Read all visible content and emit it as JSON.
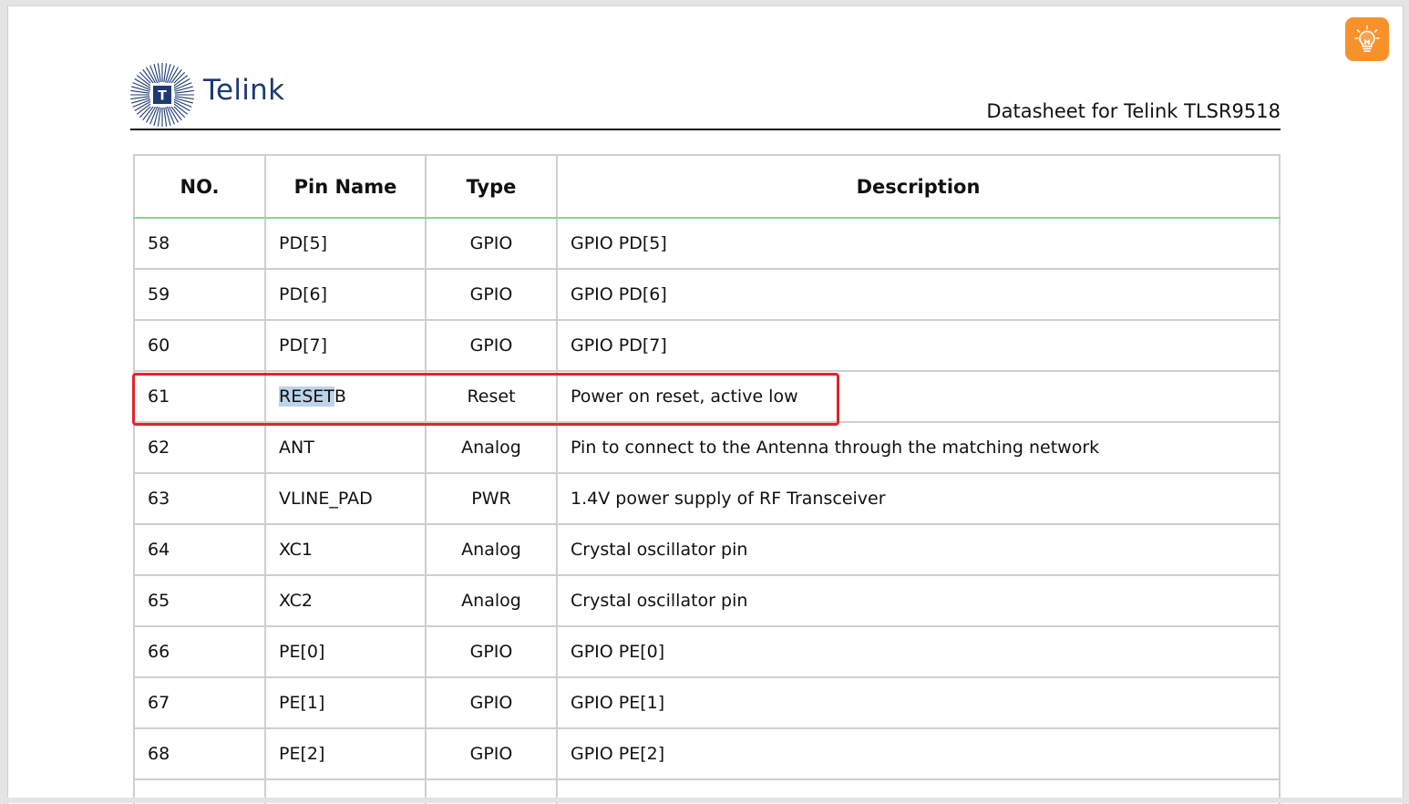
{
  "header": {
    "brand": "Telink",
    "logo_letter": "T",
    "title": "Datasheet for Telink TLSR9518"
  },
  "toolbar": {
    "idea_icon": "lightbulb-icon",
    "idea_color": "#f7922a"
  },
  "table": {
    "columns": [
      "NO.",
      "Pin Name",
      "Type",
      "Description"
    ],
    "rows": [
      {
        "no": "58",
        "pin": "PD[5]",
        "type": "GPIO",
        "desc": "GPIO PD[5]"
      },
      {
        "no": "59",
        "pin": "PD[6]",
        "type": "GPIO",
        "desc": "GPIO PD[6]"
      },
      {
        "no": "60",
        "pin": "PD[7]",
        "type": "GPIO",
        "desc": "GPIO PD[7]"
      },
      {
        "no": "61",
        "pin_selected": "RESET",
        "pin_rest": "B",
        "type": "Reset",
        "desc": "Power on reset, active low"
      },
      {
        "no": "62",
        "pin": "ANT",
        "type": "Analog",
        "desc": "Pin to connect to the Antenna through the matching network"
      },
      {
        "no": "63",
        "pin": "VLINE_PAD",
        "type": "PWR",
        "desc": "1.4V power supply of RF Transceiver"
      },
      {
        "no": "64",
        "pin": "XC1",
        "type": "Analog",
        "desc": "Crystal oscillator pin"
      },
      {
        "no": "65",
        "pin": "XC2",
        "type": "Analog",
        "desc": "Crystal oscillator pin"
      },
      {
        "no": "66",
        "pin": "PE[0]",
        "type": "GPIO",
        "desc": "GPIO PE[0]"
      },
      {
        "no": "67",
        "pin": "PE[1]",
        "type": "GPIO",
        "desc": "GPIO PE[1]"
      },
      {
        "no": "68",
        "pin": "PE[2]",
        "type": "GPIO",
        "desc": "GPIO PE[2]"
      }
    ]
  },
  "colors": {
    "brand_blue": "#1d3a73",
    "highlight_red": "#e3242b",
    "header_underline_green": "#8fd49a",
    "selection_blue": "#bcd3ea"
  }
}
